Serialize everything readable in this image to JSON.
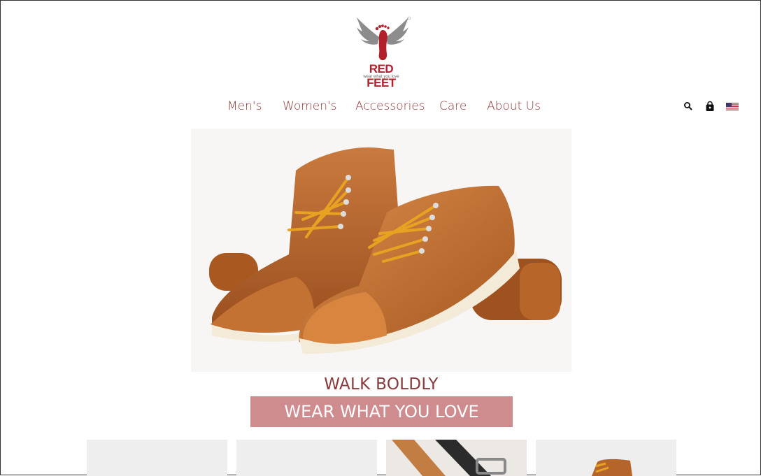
{
  "brand": {
    "name": "RED FEET",
    "tagline": "wear what you love",
    "colors": {
      "primary": "#b11f2a",
      "wing": "#8c8c8c"
    }
  },
  "nav": {
    "items": [
      {
        "label": "Men's"
      },
      {
        "label": "Women's"
      },
      {
        "label": "Accessories"
      },
      {
        "label": "Care"
      },
      {
        "label": "About Us"
      }
    ]
  },
  "header_icons": {
    "search": "search-icon",
    "cart": "shopping-bag-icon",
    "locale": "us-flag-icon"
  },
  "hero": {
    "image": "brown-leather-moc-toe-boots-and-shoe",
    "headline": "WALK BOLDLY",
    "cta_label": "WEAR WHAT YOU LOVE",
    "cta_color": "#cf8c8f"
  },
  "tiles": [
    {
      "image": "blank"
    },
    {
      "image": "blank"
    },
    {
      "image": "leather-belts"
    },
    {
      "image": "brown-boot"
    }
  ]
}
